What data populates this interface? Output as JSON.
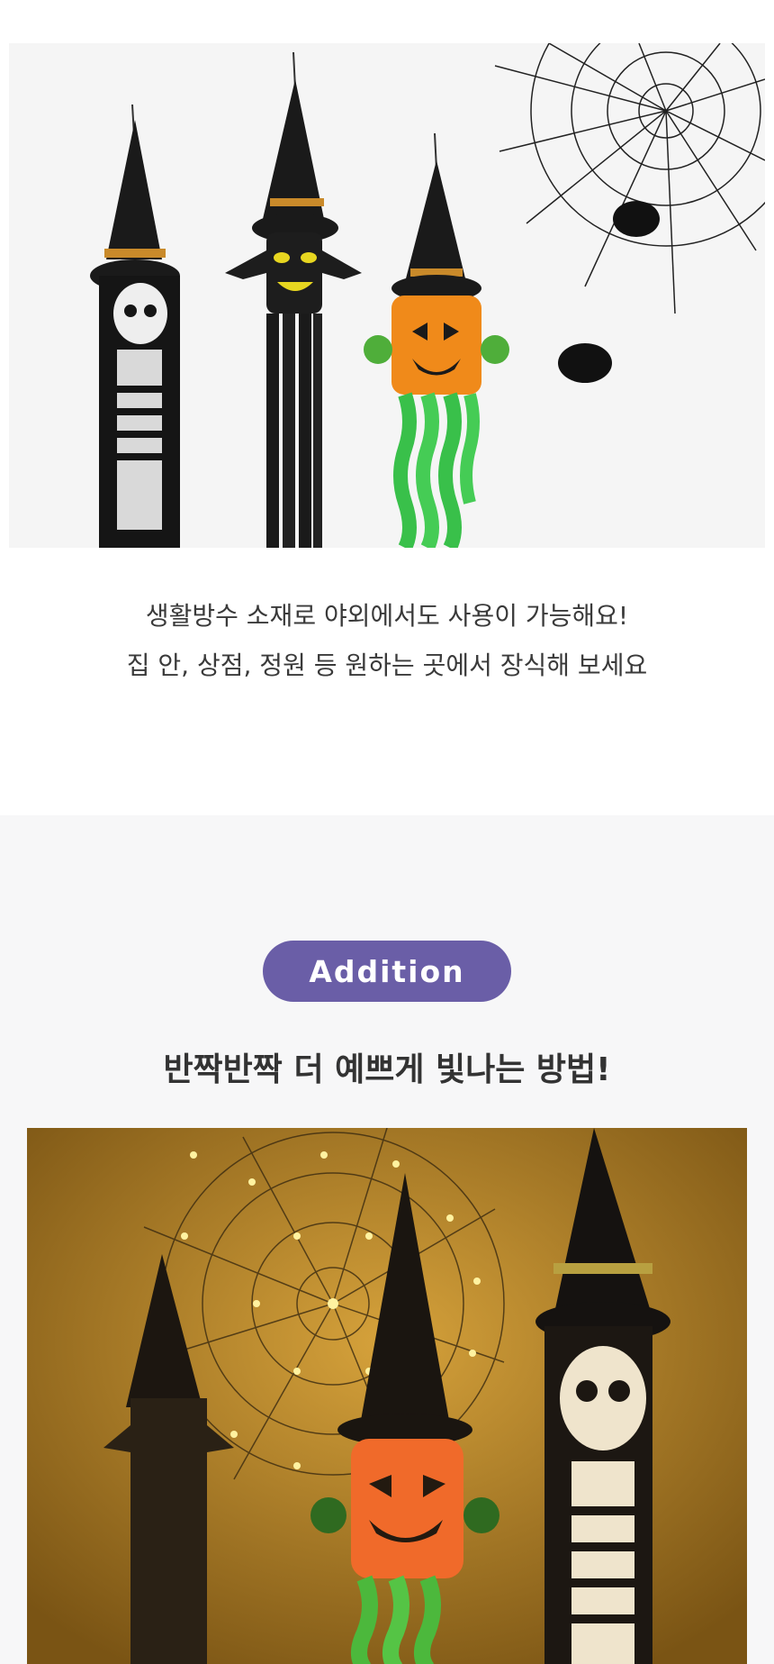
{
  "top_section": {
    "description_lines": [
      "생활방수 소재로 야외에서도 사용이 가능해요!",
      "집 안, 상점, 정원 등 원하는 곳에서 장식해 보세요"
    ]
  },
  "addition_section": {
    "badge_label": "Addition",
    "headline": "반짝반짝 더 예쁘게 빛나는 방법!"
  },
  "colors": {
    "badge": "#6a5ea7",
    "text": "#333333",
    "bottom_background": "#f7f7f8"
  }
}
